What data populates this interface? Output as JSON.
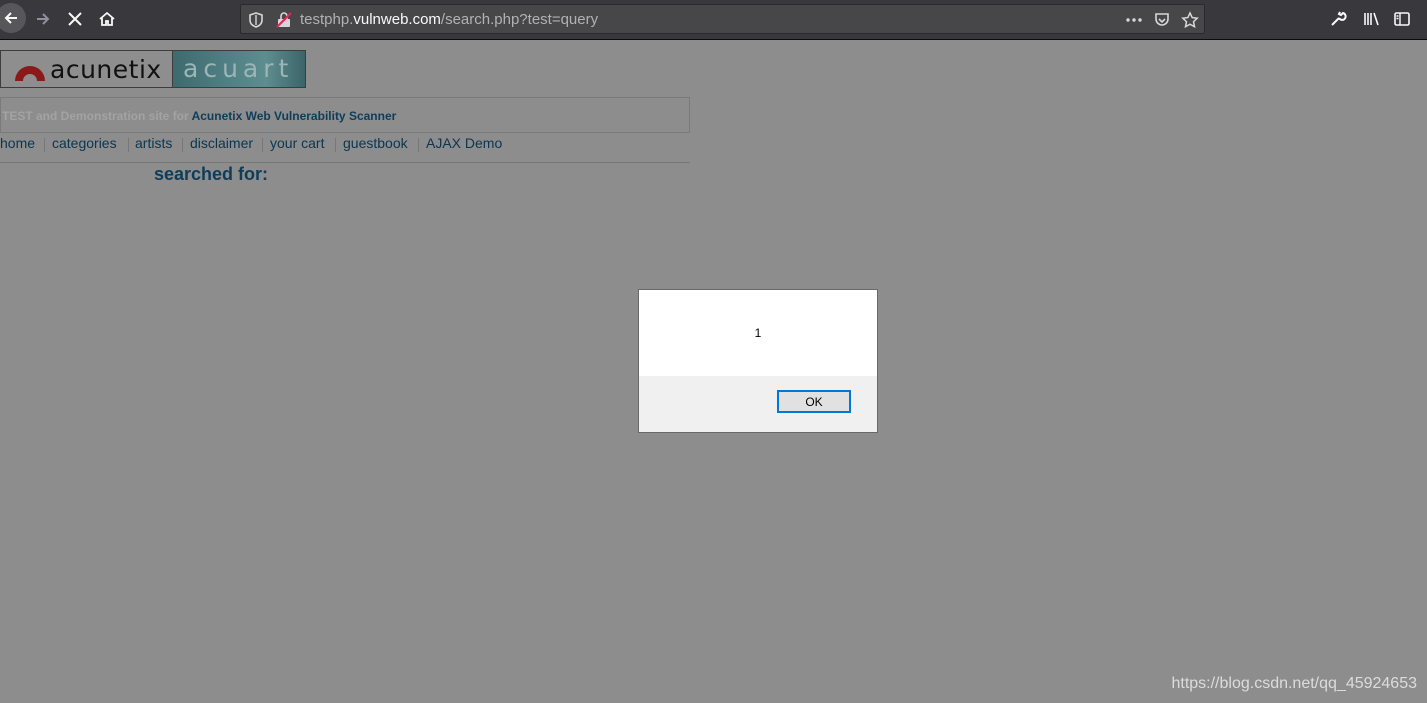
{
  "browser": {
    "url_prefix": "testphp.",
    "url_host": "vulnweb.com",
    "url_path": "/search.php?test=query"
  },
  "site": {
    "logo_text": "acunetix",
    "logo_right_text": "acuart",
    "tagline_muted": "TEST and Demonstration site for",
    "tagline_strong": "Acunetix Web Vulnerability Scanner",
    "nav": [
      "home",
      "categories",
      "artists",
      "disclaimer",
      "your cart",
      "guestbook",
      "AJAX Demo"
    ],
    "searched_label": "searched for:"
  },
  "alert": {
    "message": "1",
    "ok_label": "OK"
  },
  "watermark": "https://blog.csdn.net/qq_45924653",
  "colors": {
    "overlay": "#8d8d8d",
    "link": "#0b3550",
    "accent": "#0078d7",
    "toolbar": "#38383d"
  }
}
